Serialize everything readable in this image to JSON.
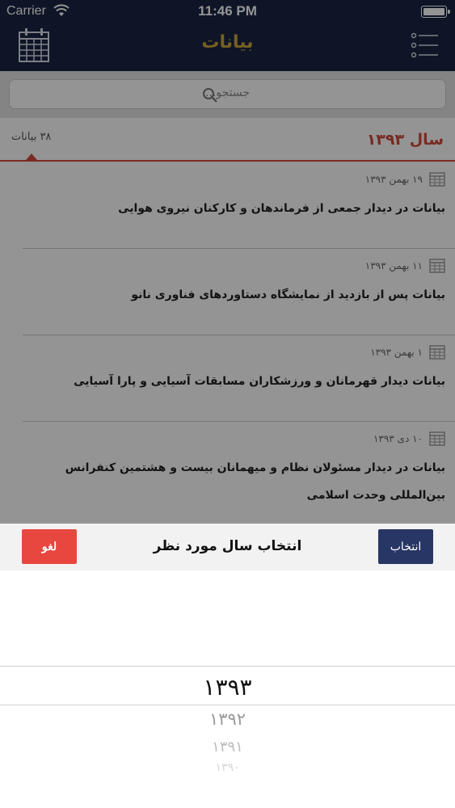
{
  "status": {
    "carrier": "Carrier",
    "time": "11:46 PM"
  },
  "header": {
    "title": "بیانات",
    "left_icon": "calendar-icon",
    "right_icon": "menu-list-icon"
  },
  "search": {
    "placeholder": "جستجو..."
  },
  "section": {
    "year_label": "سال ۱۳۹۳",
    "count_label": "۳۸ بیانات"
  },
  "items": [
    {
      "date": "۱۹ بهمن ۱۳۹۳",
      "title": "بیانات در دیدار جمعی از فرماندهان و کارکنان نیروی هوایی"
    },
    {
      "date": "۱۱ بهمن ۱۳۹۳",
      "title": "بیانات پس از بازدید از نمایشگاه دستاوردهای فناوری نانو"
    },
    {
      "date": "۱ بهمن ۱۳۹۳",
      "title": "بیانات دیدار قهرمانان و ورزشکاران مسابقات آسیایی و پارا آسیایی"
    },
    {
      "date": "۱۰ دی ۱۳۹۳",
      "title": "بیانات در دیدار مسئولان نظام و میهمانان بیست و هشتمین کنفرانس بین‌المللی وحدت اسلامی"
    }
  ],
  "picker": {
    "title": "انتخاب سال مورد نظر",
    "select_label": "انتخاب",
    "cancel_label": "لغو",
    "selected": "۱۳۹۳",
    "options": [
      "۱۳۹۲",
      "۱۳۹۱",
      "۱۳۹۰"
    ]
  },
  "colors": {
    "nav_bg": "#1b2544",
    "title_gold": "#c8a53a",
    "accent_red": "#d14a3c",
    "select_button": "#273664",
    "cancel_button": "#e8473f"
  }
}
